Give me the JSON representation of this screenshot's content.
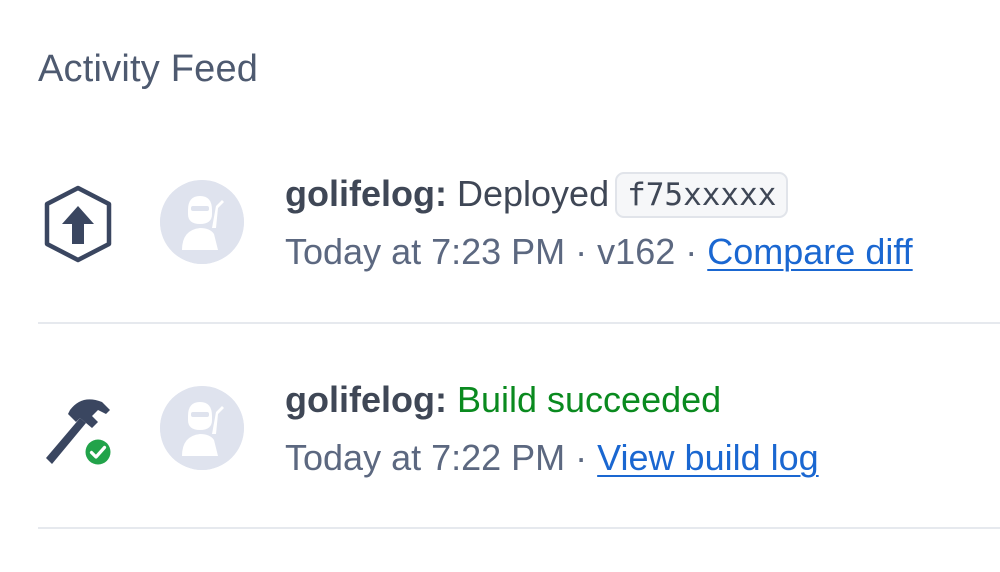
{
  "feed": {
    "title": "Activity Feed",
    "items": [
      {
        "event_icon": "deploy-upload-icon",
        "avatar_icon": "ninja-avatar-icon",
        "app": "golifelog:",
        "action": "Deployed",
        "commit": "f75xxxxx",
        "time": "Today at 7:23 PM",
        "separator": "·",
        "version": "v162",
        "link": "Compare diff"
      },
      {
        "event_icon": "hammer-success-icon",
        "avatar_icon": "ninja-avatar-icon",
        "app": "golifelog:",
        "action": "Build succeeded",
        "time": "Today at 7:22 PM",
        "separator": "·",
        "link": "View build log"
      }
    ]
  },
  "colors": {
    "title": "#4e5a70",
    "text": "#3f4756",
    "meta": "#5c6880",
    "link": "#1a67d1",
    "success": "#0a8a1f",
    "avatar_bg": "#dfe3ee",
    "divider": "#e6e9ee"
  }
}
